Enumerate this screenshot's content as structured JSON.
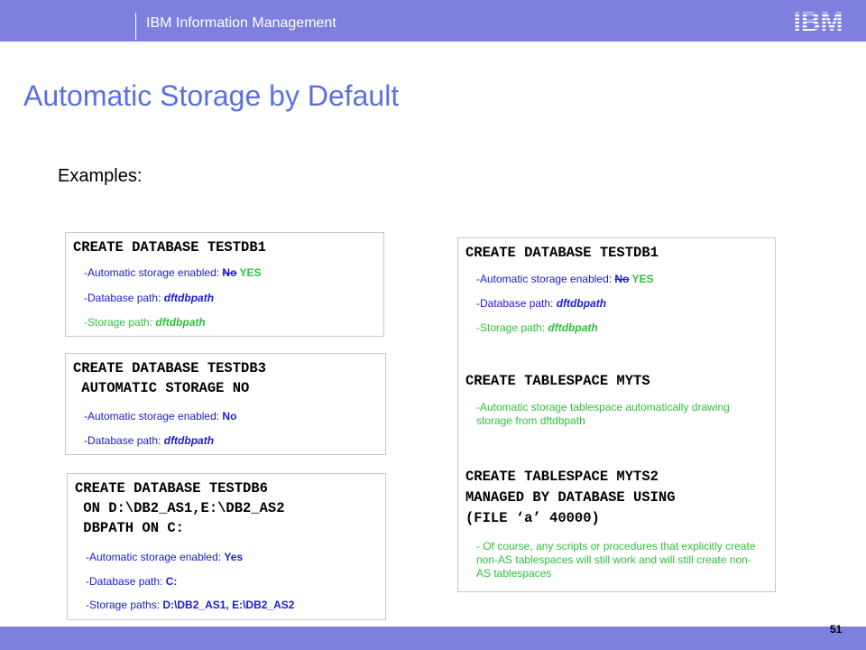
{
  "header": {
    "org": "IBM Information Management",
    "logo_text": "IBM"
  },
  "slide": {
    "title": "Automatic Storage by Default",
    "examples_label": "Examples:",
    "page_number": "51"
  },
  "box1": {
    "code": "CREATE DATABASE TESTDB1",
    "n1_prefix": "-Automatic storage enabled: ",
    "n1_old": "No",
    "n1_new": " YES",
    "n2_prefix": "-Database path: ",
    "n2_value": "dftdbpath",
    "n3_prefix": "-Storage path: ",
    "n3_value": "dftdbpath"
  },
  "box2": {
    "code1": "CREATE DATABASE TESTDB3",
    "code2": " AUTOMATIC STORAGE NO",
    "n1_prefix": "-Automatic storage enabled: ",
    "n1_value": "No",
    "n2_prefix": "-Database path: ",
    "n2_value": "dftdbpath"
  },
  "box3": {
    "code1": "CREATE DATABASE TESTDB6",
    "code2": " ON D:\\DB2_AS1,E:\\DB2_AS2",
    "code3": " DBPATH ON C:",
    "n1_prefix": "-Automatic storage enabled: ",
    "n1_value": "Yes",
    "n2_prefix": "-Database path: ",
    "n2_value": "C:",
    "n3_prefix": "-Storage paths: ",
    "n3_value": "D:\\DB2_AS1, E:\\DB2_AS2"
  },
  "box4": {
    "code1": "CREATE DATABASE TESTDB1",
    "n1_prefix": "-Automatic storage enabled: ",
    "n1_old": "No",
    "n1_new": " YES",
    "n2_prefix": "-Database path: ",
    "n2_value": "dftdbpath",
    "n3_prefix": "-Storage path: ",
    "n3_value": "dftdbpath",
    "code2": "CREATE TABLESPACE MYTS",
    "n4": "-Automatic storage tablespace automatically drawing storage from dftdbpath",
    "code3a": "CREATE TABLESPACE MYTS2",
    "code3b": "MANAGED BY DATABASE USING",
    "code3c": "(FILE ‘a’ 40000)",
    "n5": "- Of course, any scripts or procedures that explicitly create non-AS tablespaces will still work and will still create non-AS tablespaces"
  },
  "colors": {
    "bar": "#7f7fdf",
    "title": "#5b6fe3",
    "green": "#2fbf3a",
    "blue": "#1a1ad0"
  }
}
